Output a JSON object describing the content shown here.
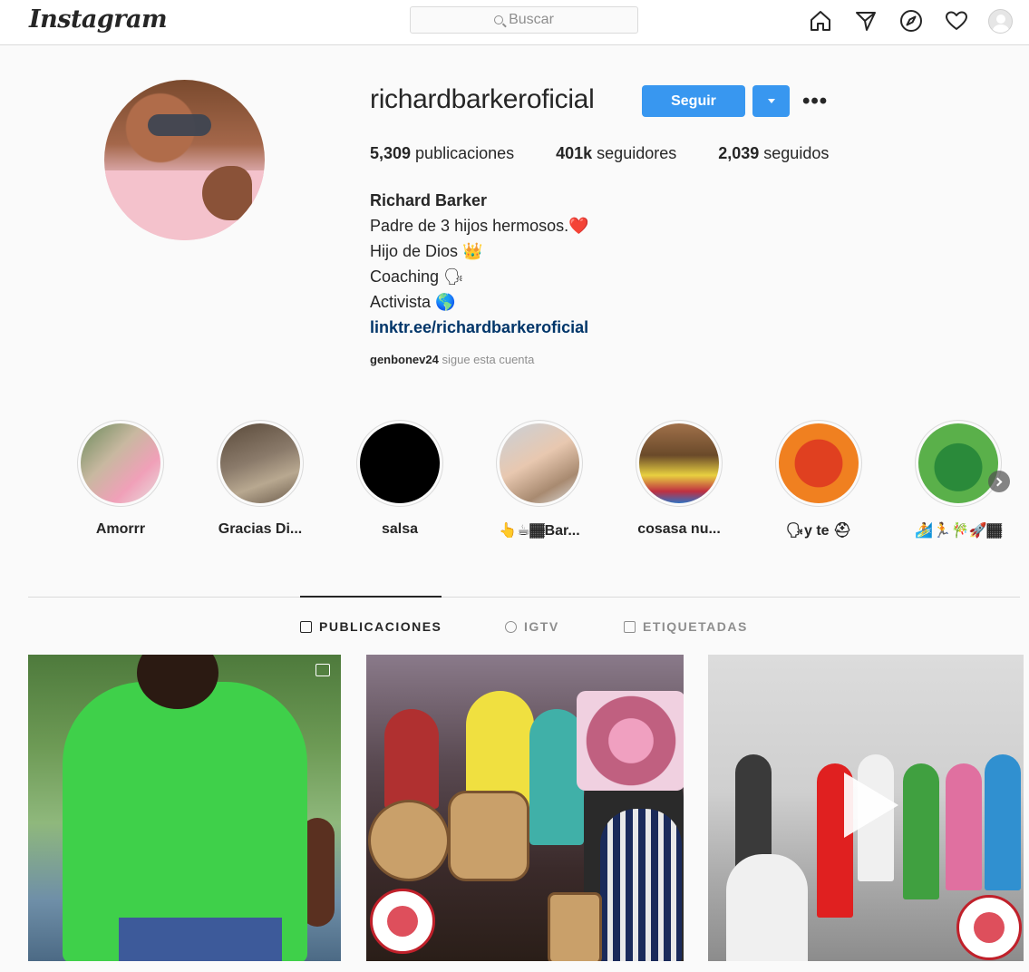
{
  "nav": {
    "logo": "Instagram",
    "search_placeholder": "Buscar",
    "icons": [
      "home-icon",
      "direct-icon",
      "explore-icon",
      "heart-icon",
      "profile-avatar"
    ]
  },
  "profile": {
    "username": "richardbarkeroficial",
    "follow_label": "Seguir",
    "more_label": "•••",
    "stats": [
      {
        "count": "5,309",
        "label": " publicaciones"
      },
      {
        "count": "401k",
        "label": " seguidores"
      },
      {
        "count": "2,039",
        "label": " seguidos"
      }
    ],
    "full_name": "Richard Barker",
    "bio_lines": [
      "Padre de 3 hijos hermosos.❤️",
      "Hijo de Dios 👑",
      "Coaching 🗣",
      "Activista 🌎"
    ],
    "link": "linktr.ee/richardbarkeroficial",
    "followed_by_user": "genbonev24",
    "followed_by_text": " sigue esta cuenta"
  },
  "highlights": [
    {
      "label": "Amorrr"
    },
    {
      "label": "Gracias Di..."
    },
    {
      "label": "salsa"
    },
    {
      "label": "👆☕🏾Bar..."
    },
    {
      "label": "cosasa nu..."
    },
    {
      "label": "🗣y te ⛑"
    },
    {
      "label": "🏄🏃🎋🚀🏾"
    }
  ],
  "tabs": [
    {
      "label": "PUBLICACIONES",
      "active": true
    },
    {
      "label": "IGTV",
      "active": false
    },
    {
      "label": "ETIQUETADAS",
      "active": false
    }
  ],
  "colors": {
    "accent": "#3897f0",
    "link": "#003569",
    "border": "#dbdbdb",
    "muted": "#8e8e8e"
  }
}
